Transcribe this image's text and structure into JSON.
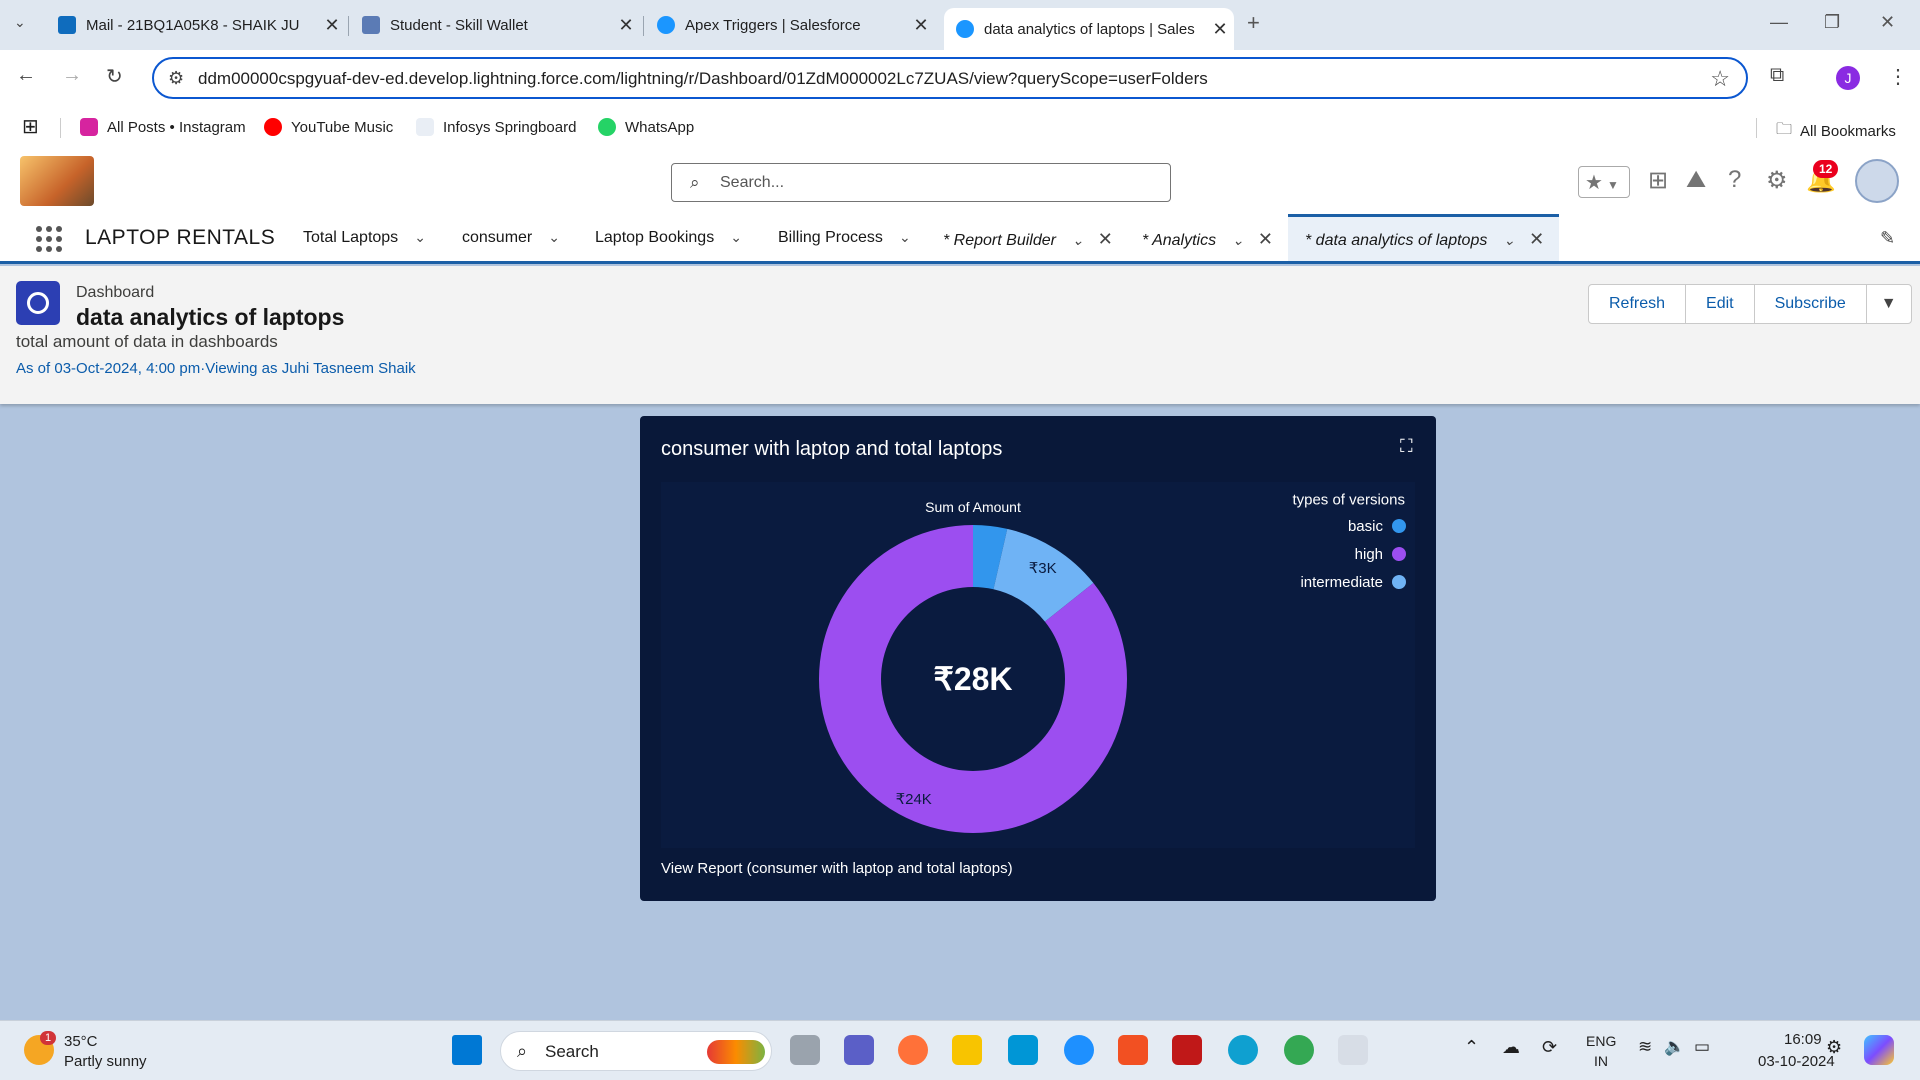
{
  "browser": {
    "tabs": [
      {
        "title": "Mail - 21BQ1A05K8 - SHAIK JU",
        "color": "#0f6cbd"
      },
      {
        "title": "Student - Skill Wallet",
        "color": "#5b7bb5"
      },
      {
        "title": "Apex Triggers | Salesforce",
        "color": "#1b96ff"
      },
      {
        "title": "data analytics of laptops | Sales",
        "color": "#1b96ff"
      }
    ],
    "url": "ddm00000cspgyuaf-dev-ed.develop.lightning.force.com/lightning/r/Dashboard/01ZdM000002Lc7ZUAS/view?queryScope=userFolders",
    "profile_initial": "J",
    "bookmarks": [
      {
        "label": "All Posts • Instagram",
        "color": "#d6249f"
      },
      {
        "label": "YouTube Music",
        "color": "#ff0000"
      },
      {
        "label": "Infosys Springboard",
        "color": "#e9eef5"
      },
      {
        "label": "WhatsApp",
        "color": "#25d366"
      }
    ],
    "all_bookmarks": "All Bookmarks"
  },
  "sf": {
    "search_placeholder": "Search...",
    "notification_count": "12",
    "app_name": "LAPTOP RENTALS",
    "nav": [
      {
        "label": "Total Laptops"
      },
      {
        "label": "consumer"
      },
      {
        "label": "Laptop Bookings"
      },
      {
        "label": "Billing Process"
      },
      {
        "label": "* Report Builder"
      },
      {
        "label": "* Analytics"
      },
      {
        "label": "* data analytics of laptops"
      }
    ]
  },
  "dashboard": {
    "type_label": "Dashboard",
    "title": "data analytics of laptops",
    "description": "total amount of data in dashboards",
    "as_of": "As of 03-Oct-2024, 4:00 pm·Viewing as Juhi Tasneem Shaik",
    "buttons": {
      "refresh": "Refresh",
      "edit": "Edit",
      "subscribe": "Subscribe"
    }
  },
  "widget": {
    "title": "consumer with laptop and total laptops",
    "link": "View Report (consumer with laptop and total laptops)"
  },
  "chart_data": {
    "type": "pie",
    "variant": "donut",
    "title": "Sum of Amount",
    "center_label": "₹28K",
    "legend_title": "types of versions",
    "legend_position": "top-right",
    "categories": [
      "basic",
      "high",
      "intermediate"
    ],
    "values": [
      1,
      24,
      3
    ],
    "slice_labels": [
      "",
      "₹24K",
      "₹3K"
    ],
    "colors": [
      "#3296ed",
      "#9c4ef0",
      "#6fb3f5"
    ]
  },
  "taskbar": {
    "temperature": "35°C",
    "weather": "Partly sunny",
    "search": "Search",
    "lang": "ENG",
    "region": "IN",
    "time": "16:09",
    "date": "03-10-2024",
    "weather_badge": "1"
  }
}
